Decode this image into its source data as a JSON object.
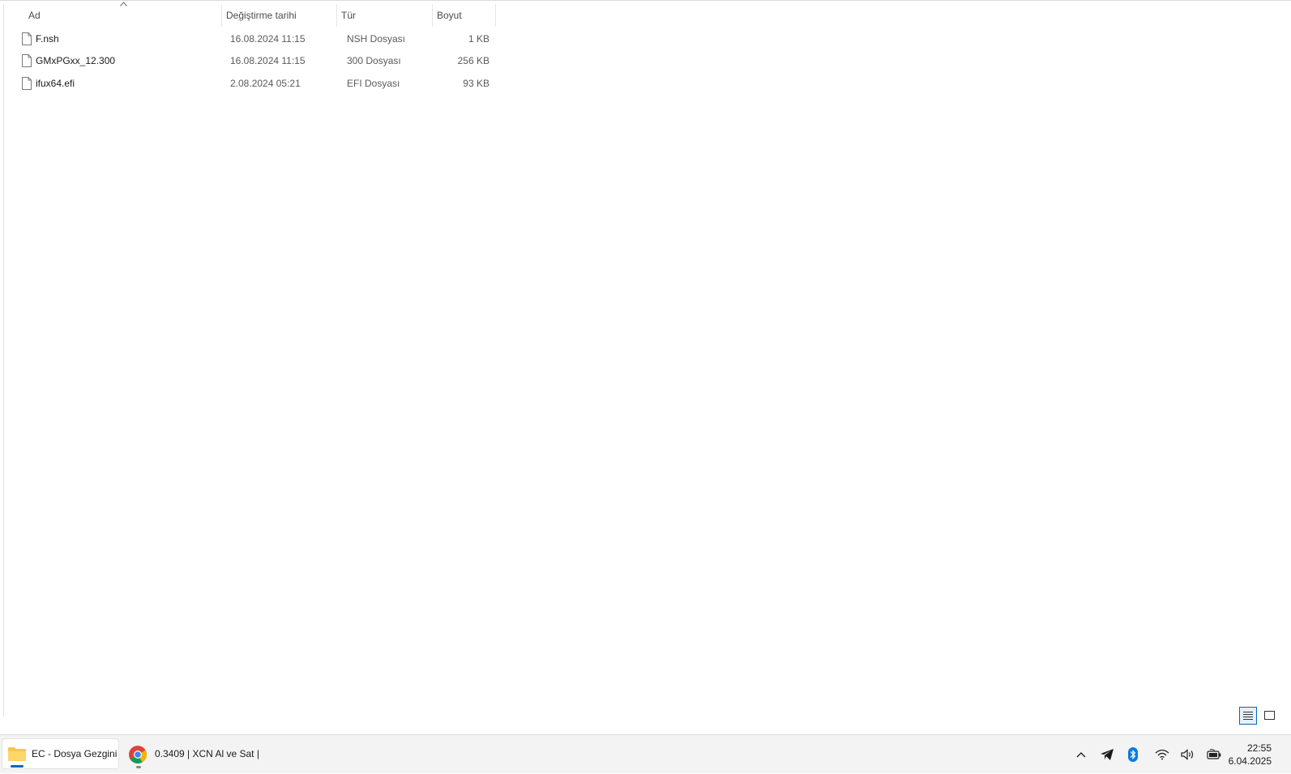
{
  "columns": {
    "name": "Ad",
    "date": "Değiştirme tarihi",
    "type": "Tür",
    "size": "Boyut"
  },
  "files": [
    {
      "name": "F.nsh",
      "date": "16.08.2024 11:15",
      "type": "NSH Dosyası",
      "size": "1 KB"
    },
    {
      "name": "GMxPGxx_12.300",
      "date": "16.08.2024 11:15",
      "type": "300 Dosyası",
      "size": "256 KB"
    },
    {
      "name": "ifux64.efi",
      "date": "2.08.2024 05:21",
      "type": "EFI Dosyası",
      "size": "93 KB"
    }
  ],
  "view_modes": [
    "details-view-icon",
    "large-icons-view-icon"
  ],
  "taskbar": {
    "apps": [
      {
        "label": "EC - Dosya Gezgini",
        "icon": "folder-icon",
        "active": true
      },
      {
        "label": "0.3409 | XCN Al ve Sat |",
        "icon": "chrome-icon",
        "active": false
      }
    ],
    "tray_icons": [
      "chevron-up-icon",
      "telegram-icon",
      "bluetooth-icon",
      "wifi-icon",
      "volume-icon",
      "battery-icon"
    ],
    "clock": {
      "time": "22:55",
      "date": "6.04.2025"
    }
  },
  "colors": {
    "accent": "#0067c0",
    "folder": "#f8c74a",
    "telegram": "#1a1a1a",
    "bluetooth": "#0a7ae0"
  }
}
